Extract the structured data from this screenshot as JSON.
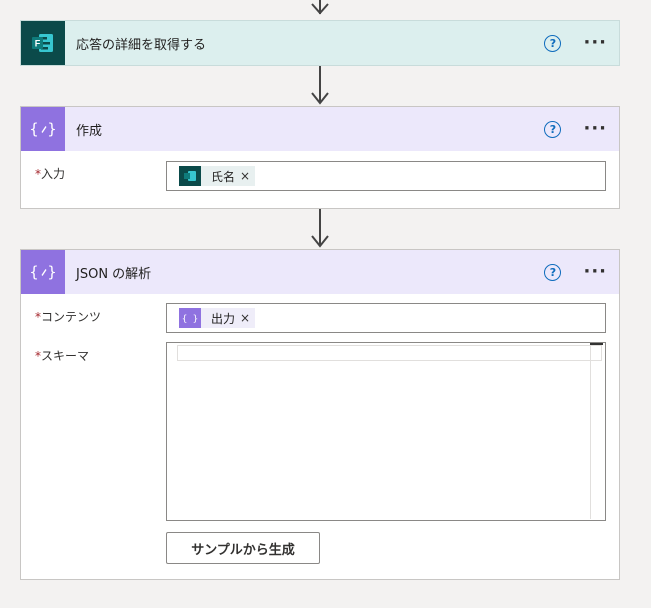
{
  "forms_step": {
    "title": "応答の詳細を取得する",
    "help_label": "?",
    "more_label": "···"
  },
  "compose_step": {
    "title": "作成",
    "help_label": "?",
    "more_label": "···",
    "input_label": "入力",
    "required_marker": "*",
    "input_token": "氏名",
    "token_close": "×"
  },
  "parse_step": {
    "title": "JSON の解析",
    "help_label": "?",
    "more_label": "···",
    "content_label": "コンテンツ",
    "schema_label": "スキーマ",
    "required_marker": "*",
    "content_token": "出力",
    "token_close": "×",
    "generate_button": "サンプルから生成"
  },
  "colors": {
    "forms_badge": "#0b4a4a",
    "forms_header": "#dcefee",
    "compose_badge": "#8f72e0",
    "compose_header": "#ece8fb",
    "help_icon": "#0f6cbd",
    "required": "#a4262c"
  },
  "icons": {
    "forms": "microsoft-forms-icon",
    "compose": "data-operation-icon",
    "help": "question-circle-icon",
    "more": "ellipsis-icon",
    "arrow": "arrow-down-icon",
    "close": "close-icon"
  }
}
